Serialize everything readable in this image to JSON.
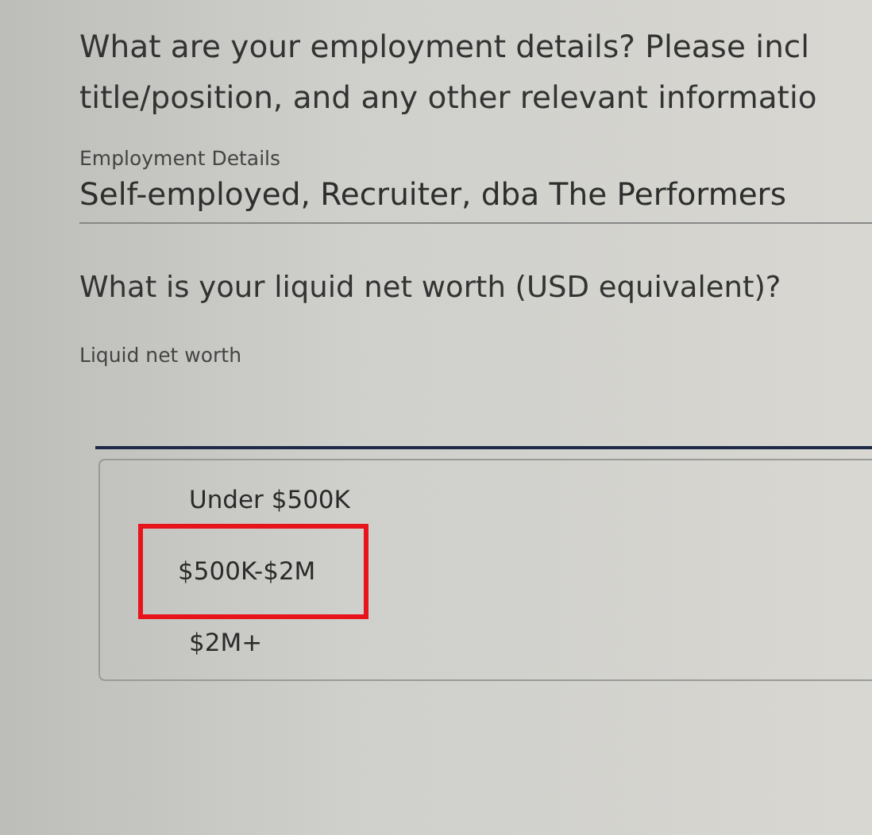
{
  "employment": {
    "question_lines": [
      "What are your employment details? Please incl",
      "title/position, and any other relevant informatio"
    ],
    "field": {
      "label": "Employment Details",
      "value": "Self-employed, Recruiter, dba The Performers"
    }
  },
  "net_worth": {
    "question": "What is your liquid net worth (USD equivalent)?",
    "field": {
      "label": "Liquid net worth",
      "expanded": true
    },
    "options": [
      {
        "label": "Under $500K",
        "highlighted": false
      },
      {
        "label": "$500K-$2M",
        "highlighted": true
      },
      {
        "label": "$2M+",
        "highlighted": false
      }
    ]
  }
}
